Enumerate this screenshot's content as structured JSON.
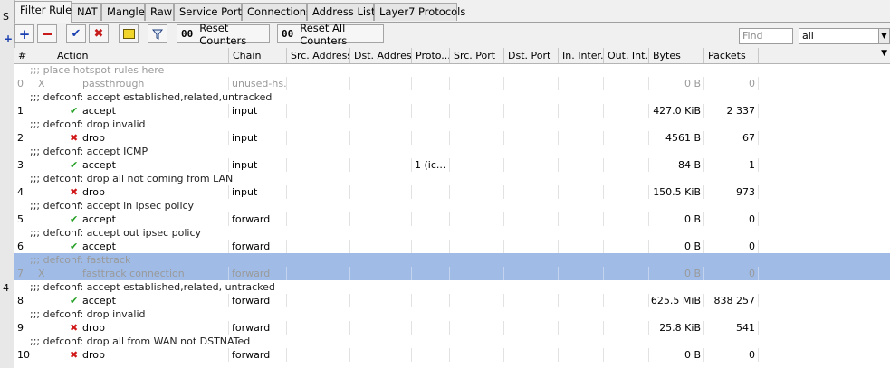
{
  "gutter": {
    "letter": "S",
    "plus": "+",
    "num": "4"
  },
  "tabs": [
    "Filter Rules",
    "NAT",
    "Mangle",
    "Raw",
    "Service Ports",
    "Connections",
    "Address Lists",
    "Layer7 Protocols"
  ],
  "toolbar": {
    "add": "+",
    "remove": "−",
    "enable": "✔",
    "disable": "✖",
    "comment_icon": "comment-icon",
    "filter_icon": "filter-icon",
    "reset_prefix": "00",
    "reset_counters": "Reset Counters",
    "reset_all_prefix": "00",
    "reset_all_counters": "Reset All Counters",
    "find_placeholder": "Find",
    "filter_select": "all"
  },
  "columns": [
    "#",
    "Action",
    "Chain",
    "Src. Address",
    "Dst. Address",
    "Proto...",
    "Src. Port",
    "Dst. Port",
    "In. Inter...",
    "Out. Int...",
    "Bytes",
    "Packets"
  ],
  "rows": [
    {
      "type": "comment",
      "text": ";;; place hotspot rules here",
      "disabled": true
    },
    {
      "type": "rule",
      "num": "0",
      "flag": "X",
      "icon": "none",
      "action": "passthrough",
      "chain": "unused-hs...",
      "proto": "",
      "bytes": "0 B",
      "packets": "0",
      "disabled": true
    },
    {
      "type": "comment",
      "text": ";;; defconf: accept established,related,untracked"
    },
    {
      "type": "rule",
      "num": "1",
      "flag": "",
      "icon": "accept",
      "action": "accept",
      "chain": "input",
      "proto": "",
      "bytes": "427.0 KiB",
      "packets": "2 337"
    },
    {
      "type": "comment",
      "text": ";;; defconf: drop invalid"
    },
    {
      "type": "rule",
      "num": "2",
      "flag": "",
      "icon": "drop",
      "action": "drop",
      "chain": "input",
      "proto": "",
      "bytes": "4561 B",
      "packets": "67"
    },
    {
      "type": "comment",
      "text": ";;; defconf: accept ICMP"
    },
    {
      "type": "rule",
      "num": "3",
      "flag": "",
      "icon": "accept",
      "action": "accept",
      "chain": "input",
      "proto": "1 (ic...",
      "bytes": "84 B",
      "packets": "1"
    },
    {
      "type": "comment",
      "text": ";;; defconf: drop all not coming from LAN"
    },
    {
      "type": "rule",
      "num": "4",
      "flag": "",
      "icon": "drop",
      "action": "drop",
      "chain": "input",
      "proto": "",
      "bytes": "150.5 KiB",
      "packets": "973"
    },
    {
      "type": "comment",
      "text": ";;; defconf: accept in ipsec policy"
    },
    {
      "type": "rule",
      "num": "5",
      "flag": "",
      "icon": "accept",
      "action": "accept",
      "chain": "forward",
      "proto": "",
      "bytes": "0 B",
      "packets": "0"
    },
    {
      "type": "comment",
      "text": ";;; defconf: accept out ipsec policy"
    },
    {
      "type": "rule",
      "num": "6",
      "flag": "",
      "icon": "accept",
      "action": "accept",
      "chain": "forward",
      "proto": "",
      "bytes": "0 B",
      "packets": "0"
    },
    {
      "type": "comment",
      "text": ";;; defconf: fasttrack",
      "disabled": true,
      "selected": true
    },
    {
      "type": "rule",
      "num": "7",
      "flag": "X",
      "icon": "none",
      "action": "fasttrack connection",
      "chain": "forward",
      "proto": "",
      "bytes": "0 B",
      "packets": "0",
      "disabled": true,
      "selected": true
    },
    {
      "type": "comment",
      "text": ";;; defconf: accept established,related, untracked"
    },
    {
      "type": "rule",
      "num": "8",
      "flag": "",
      "icon": "accept",
      "action": "accept",
      "chain": "forward",
      "proto": "",
      "bytes": "625.5 MiB",
      "packets": "838 257"
    },
    {
      "type": "comment",
      "text": ";;; defconf: drop invalid"
    },
    {
      "type": "rule",
      "num": "9",
      "flag": "",
      "icon": "drop",
      "action": "drop",
      "chain": "forward",
      "proto": "",
      "bytes": "25.8 KiB",
      "packets": "541"
    },
    {
      "type": "comment",
      "text": ";;; defconf:  drop all from WAN not DSTNATed"
    },
    {
      "type": "rule",
      "num": "10",
      "flag": "",
      "icon": "drop",
      "action": "drop",
      "chain": "forward",
      "proto": "",
      "bytes": "0 B",
      "packets": "0"
    }
  ],
  "colors": {
    "selected_row": "#9fbbe6",
    "accept_icon": "#1f9e1f",
    "drop_icon": "#d01818",
    "add_icon": "#1a3fb0"
  }
}
